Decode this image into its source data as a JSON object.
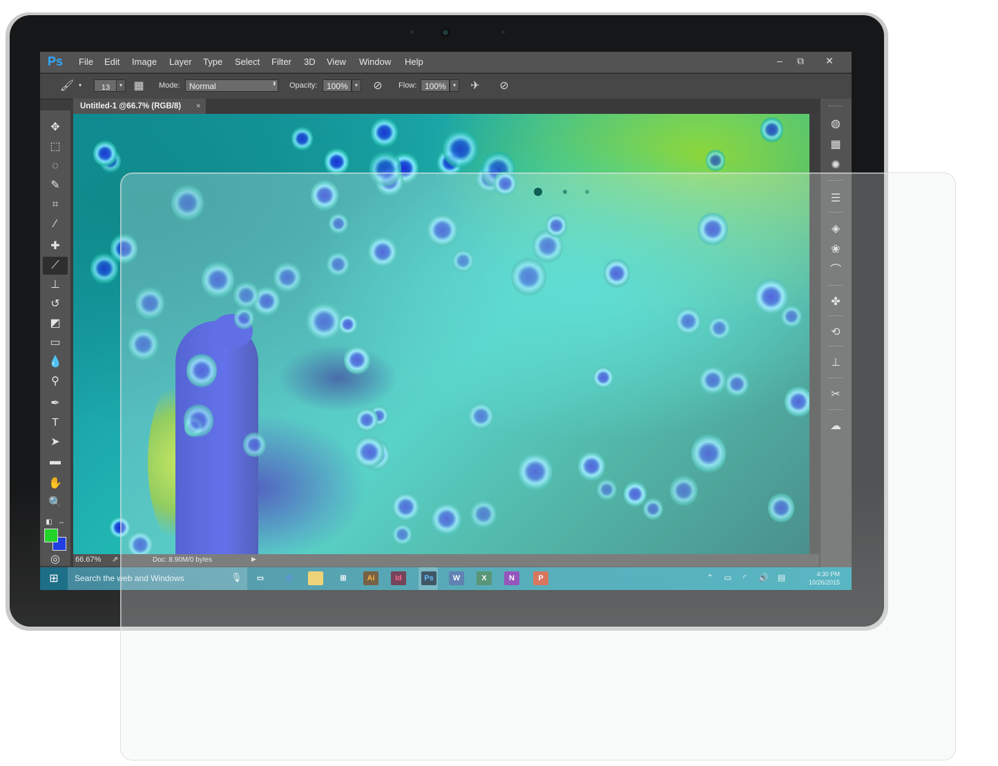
{
  "app": {
    "logo": "Ps",
    "menu": [
      "File",
      "Edit",
      "Image",
      "Layer",
      "Type",
      "Select",
      "Filter",
      "3D",
      "View",
      "Window",
      "Help"
    ],
    "window_controls": {
      "minimize": "‒",
      "restore": "⧉",
      "close": "✕"
    }
  },
  "options_bar": {
    "brush_size": "13",
    "mode_label": "Mode:",
    "mode_value": "Normal",
    "opacity_label": "Opacity:",
    "opacity_value": "100%",
    "flow_label": "Flow:",
    "flow_value": "100%"
  },
  "document": {
    "tab_title": "Untitled-1 @66.7% (RGB/8)",
    "tab_close": "×"
  },
  "status": {
    "zoom": "66.67%",
    "doc_info": "Doc: 8.90M/0 bytes"
  },
  "colors": {
    "foreground": "#22d42a",
    "background": "#1f3fe0",
    "ps_accent": "#31a8ff"
  },
  "tools": [
    "move-icon",
    "marquee-icon",
    "lasso-icon",
    "quick-select-icon",
    "crop-icon",
    "eyedropper-icon",
    "healing-icon",
    "brush-icon",
    "stamp-icon",
    "history-brush-icon",
    "eraser-icon",
    "gradient-icon",
    "blur-icon",
    "dodge-icon",
    "pen-icon",
    "type-icon",
    "path-select-icon",
    "rectangle-icon",
    "hand-icon",
    "zoom-icon"
  ],
  "taskbar": {
    "search_placeholder": "Search the web and Windows",
    "apps": [
      {
        "name": "task-view",
        "label": "▭"
      },
      {
        "name": "edge",
        "label": "e"
      },
      {
        "name": "file-explorer",
        "label": "▬"
      },
      {
        "name": "store",
        "label": "⊞"
      },
      {
        "name": "illustrator",
        "label": "Ai"
      },
      {
        "name": "indesign",
        "label": "Id"
      },
      {
        "name": "photoshop",
        "label": "Ps"
      },
      {
        "name": "word",
        "label": "W"
      },
      {
        "name": "excel",
        "label": "X"
      },
      {
        "name": "onenote",
        "label": "N"
      },
      {
        "name": "powerpoint",
        "label": "P"
      }
    ],
    "time": "4:30 PM",
    "date": "10/26/2015"
  }
}
